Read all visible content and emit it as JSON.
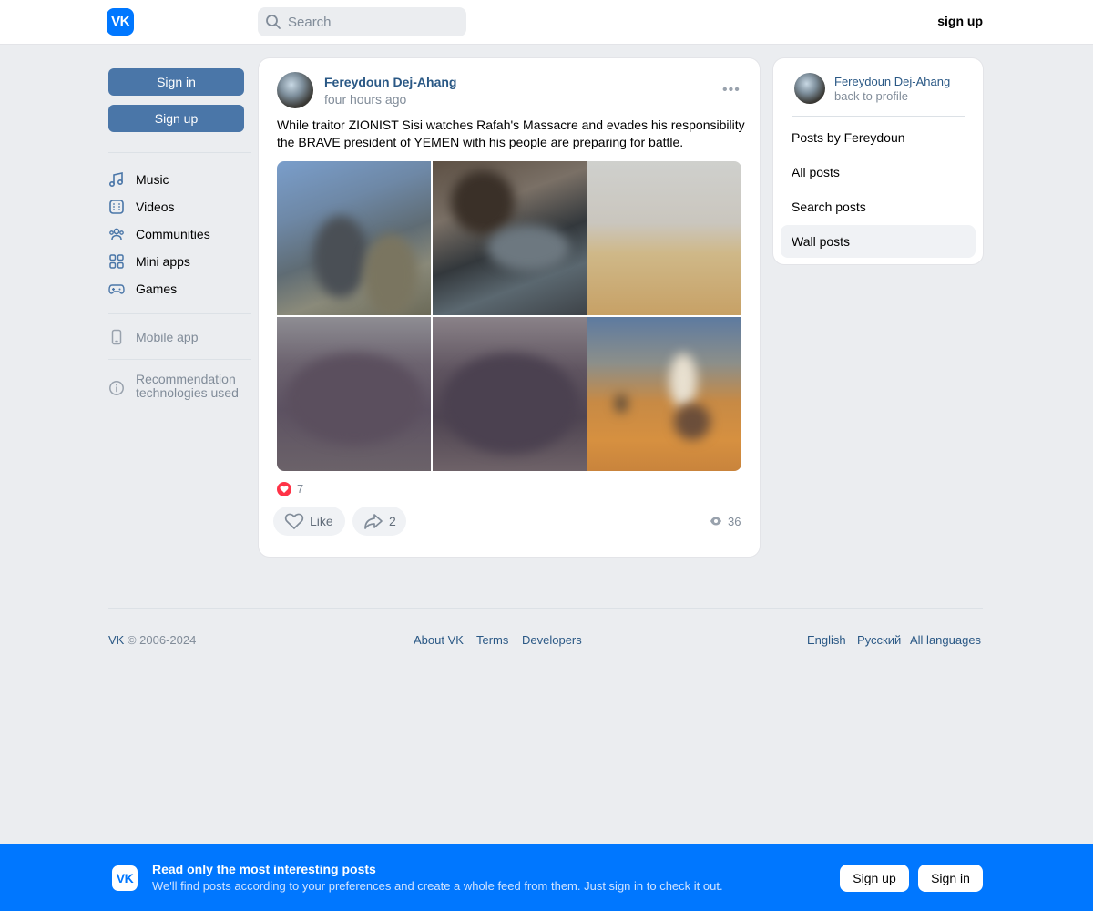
{
  "header": {
    "logo": "VK",
    "search_placeholder": "Search",
    "signup_label": "sign up"
  },
  "left": {
    "signin_label": "Sign in",
    "signup_label": "Sign up",
    "nav": [
      {
        "label": "Music",
        "icon": "music-note-icon"
      },
      {
        "label": "Videos",
        "icon": "video-icon"
      },
      {
        "label": "Communities",
        "icon": "users-icon"
      },
      {
        "label": "Mini apps",
        "icon": "grid-icon"
      },
      {
        "label": "Games",
        "icon": "gamepad-icon"
      }
    ],
    "mobile_app": "Mobile app",
    "recommendation": "Recommendation technologies used"
  },
  "post": {
    "author": "Fereydoun Dej-Ahang",
    "time": "four hours ago",
    "text": "While traitor ZIONIST Sisi watches Rafah's Massacre and evades his responsibility the BRAVE president of YEMEN with his people are preparing for battle.",
    "likes_count": "7",
    "like_label": "Like",
    "shares": "2",
    "views": "36",
    "like_color": "#ff3347"
  },
  "right": {
    "author": "Fereydoun Dej-Ahang",
    "back": "back to profile",
    "items": [
      {
        "label": "Posts by Fereydoun"
      },
      {
        "label": "All posts"
      },
      {
        "label": "Search posts"
      },
      {
        "label": "Wall posts"
      }
    ]
  },
  "footer": {
    "brand": "VK",
    "copyright": " © 2006-2024",
    "links": [
      "About VK",
      "Terms",
      "Developers"
    ],
    "languages": [
      "English",
      "Русский",
      "All languages"
    ]
  },
  "banner": {
    "logo": "VK",
    "title": "Read only the most interesting posts",
    "subtitle": "We'll find posts according to your preferences and create a whole feed from them. Just sign in to check it out.",
    "signup_label": "Sign up",
    "signin_label": "Sign in",
    "color": "#0077ff"
  }
}
